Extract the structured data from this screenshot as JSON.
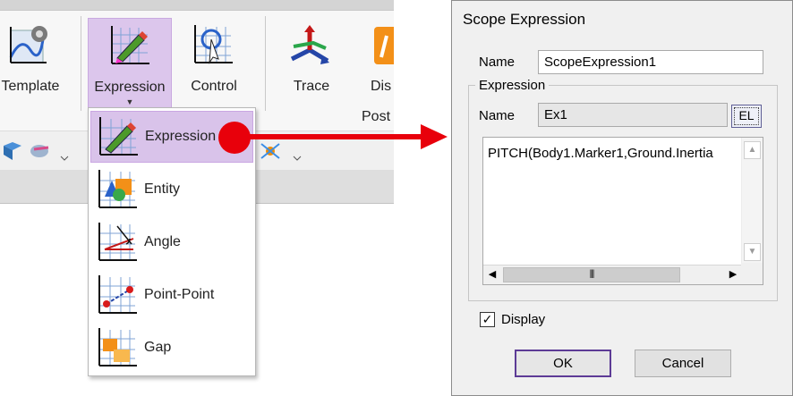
{
  "ribbon": {
    "buttons": {
      "template": "Template",
      "expression": "Expression",
      "control": "Control",
      "trace": "Trace",
      "display_partial": "Dis"
    },
    "group_label_partial": "Post"
  },
  "dropdown": {
    "items": [
      {
        "label": "Expression",
        "icon": "expression-icon"
      },
      {
        "label": "Entity",
        "icon": "entity-icon"
      },
      {
        "label": "Angle",
        "icon": "angle-icon"
      },
      {
        "label": "Point-Point",
        "icon": "point-point-icon"
      },
      {
        "label": "Gap",
        "icon": "gap-icon"
      }
    ],
    "selected_index": 0
  },
  "dialog": {
    "title": "Scope Expression",
    "name_label": "Name",
    "name_value": "ScopeExpression1",
    "group_title": "Expression",
    "expr_name_label": "Name",
    "expr_name_value": "Ex1",
    "el_button": "EL",
    "expression_text": "PITCH(Body1.Marker1,Ground.Inertia",
    "display_label": "Display",
    "display_checked": true,
    "ok_label": "OK",
    "cancel_label": "Cancel"
  },
  "colors": {
    "selection": "#d9c3ea",
    "arrow": "#e8000b",
    "dialog_bg": "#f0f0f0"
  }
}
